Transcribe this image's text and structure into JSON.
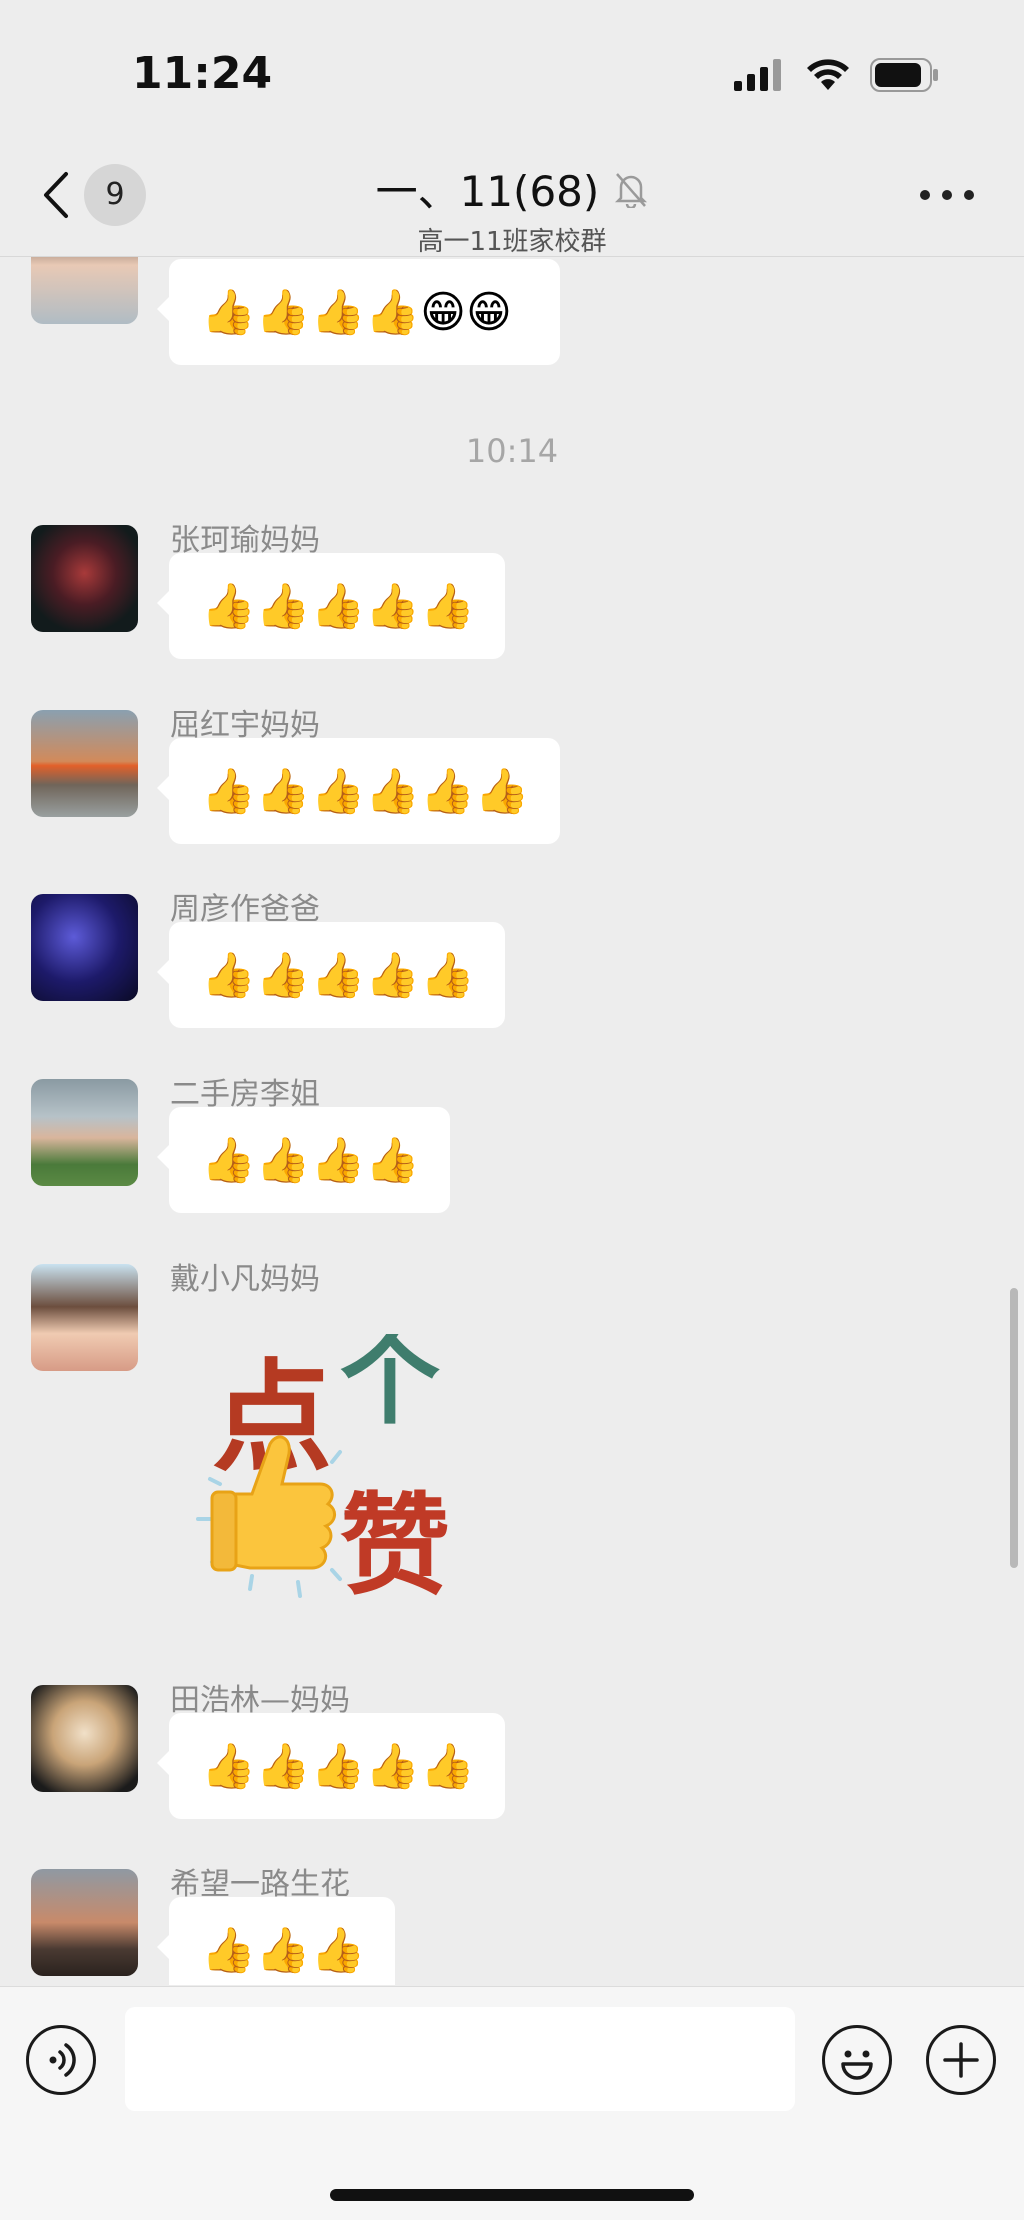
{
  "status_bar": {
    "time": "11:24"
  },
  "nav": {
    "unread_count": "9",
    "title": "一、11(68)",
    "subtitle": "高一11班家校群"
  },
  "chat": {
    "timestamp": "10:14",
    "messages": [
      {
        "sender": "",
        "content": "👍👍👍👍😁😁"
      },
      {
        "sender": "张珂瑜妈妈",
        "content": "👍👍👍👍👍"
      },
      {
        "sender": "屈红宇妈妈",
        "content": "👍👍👍👍👍👍"
      },
      {
        "sender": "周彦作爸爸",
        "content": "👍👍👍👍👍"
      },
      {
        "sender": "二手房李姐",
        "content": "👍👍👍👍"
      },
      {
        "sender": "戴小凡妈妈",
        "sticker_text": [
          "点",
          "个",
          "赞"
        ]
      },
      {
        "sender": "田浩林—妈妈",
        "content": "👍👍👍👍👍"
      },
      {
        "sender": "希望一路生花",
        "content": "👍👍👍"
      }
    ]
  },
  "input": {
    "placeholder": "",
    "value": ""
  },
  "colors": {
    "background": "#ededed",
    "bubble": "#ffffff",
    "sender_name": "#8a8a8a",
    "sticker_red": "#b53a22",
    "sticker_teal": "#3f7d6d"
  }
}
